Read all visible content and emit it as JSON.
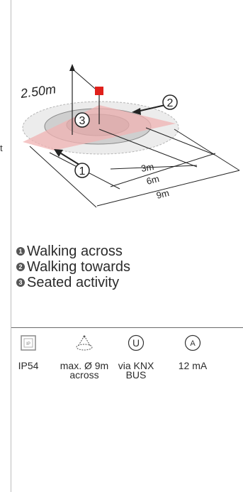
{
  "stray_char": "t",
  "diagram": {
    "height_label": "2.50m",
    "markers": [
      "1",
      "2",
      "3"
    ],
    "dimensions": [
      "3m",
      "6m",
      "9m"
    ],
    "colors": {
      "outer_ring": "#e8e8e8",
      "middle_ring": "#cfcfcf",
      "inner_ring": "#a9a9a9",
      "cone": "#f0b3b3",
      "sensor": "#e0201b"
    }
  },
  "legend": [
    {
      "num": "1",
      "label": "Walking across"
    },
    {
      "num": "2",
      "label": "Walking towards"
    },
    {
      "num": "3",
      "label": "Seated activity"
    }
  ],
  "specs": [
    {
      "icon": "ip-rating-icon",
      "label": "IP54"
    },
    {
      "icon": "detection-range-icon",
      "label": "max. Ø 9m across"
    },
    {
      "icon": "voltage-icon",
      "label": "via KNX BUS",
      "icon_letter": "U"
    },
    {
      "icon": "current-icon",
      "label": "12 mA",
      "icon_letter": "A"
    }
  ]
}
